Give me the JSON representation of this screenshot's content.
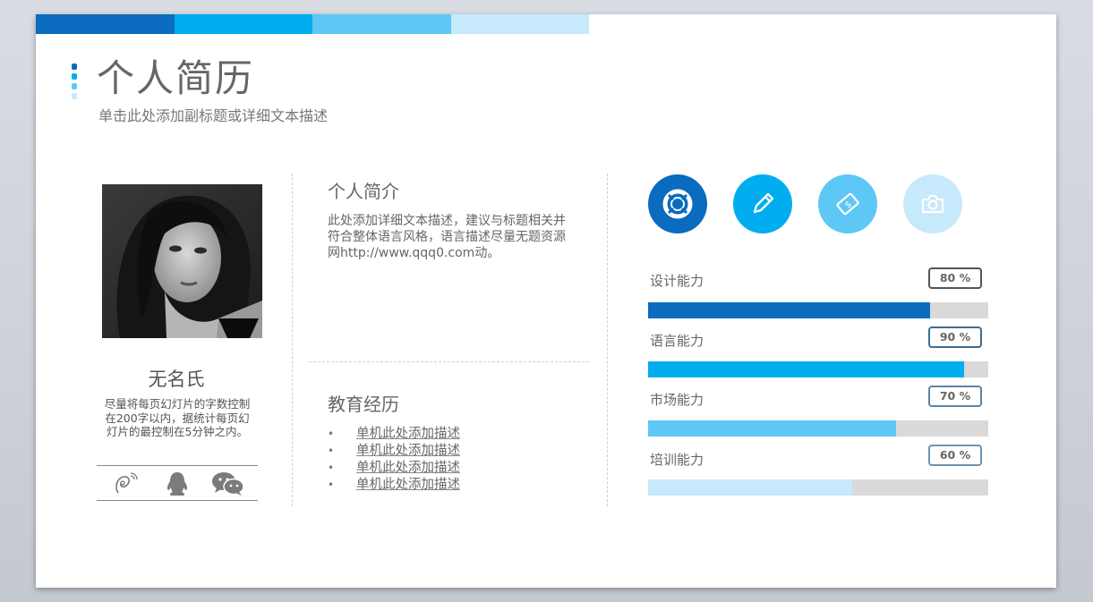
{
  "colors": {
    "dark_blue": "#0a6bbf",
    "blue": "#00adef",
    "light_blue": "#5dc8f5",
    "pale_blue": "#c6e9fb",
    "track": "#d9d9d9"
  },
  "header": {
    "title": "个人简历",
    "subtitle": "单击此处添加副标题或详细文本描述"
  },
  "profile": {
    "name": "无名氏",
    "bio": "尽量将每页幻灯片的字数控制在200字以内，据统计每页幻灯片的最控制在5分钟之内。",
    "social_icons": [
      "weibo-icon",
      "qq-penguin-icon",
      "wechat-icon"
    ]
  },
  "intro": {
    "heading": "个人简介",
    "text": "此处添加详细文本描述，建议与标题相关并符合整体语言风格，语言描述尽量无题资源网http://www.qqq0.com动。"
  },
  "education": {
    "heading": "教育经历",
    "items": [
      "单机此处添加描述",
      "单机此处添加描述",
      "单机此处添加描述",
      "单机此处添加描述"
    ]
  },
  "feature_icons": [
    "lifebuoy-icon",
    "pencil-icon",
    "ticket-icon",
    "camera-icon"
  ],
  "skills": [
    {
      "label": "设计能力",
      "percent_text": "80 %",
      "value": 0.83
    },
    {
      "label": "语言能力",
      "percent_text": "90 %",
      "value": 0.93
    },
    {
      "label": "市场能力",
      "percent_text": "70 %",
      "value": 0.73
    },
    {
      "label": "培训能力",
      "percent_text": "60 %",
      "value": 0.6
    }
  ]
}
